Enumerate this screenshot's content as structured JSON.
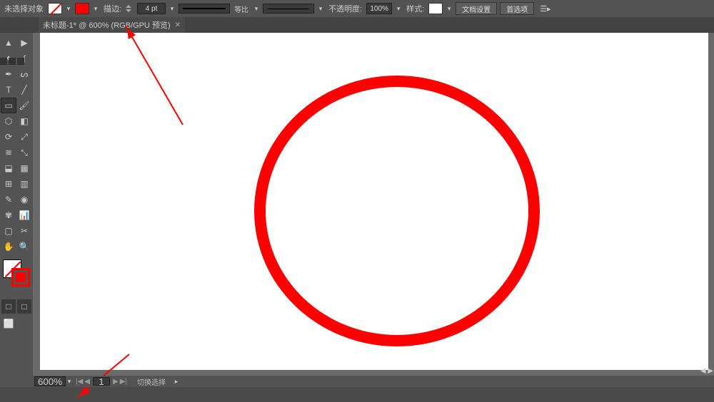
{
  "optionsBar": {
    "leftLabel": "未选择对象",
    "strokeLabel": "描边:",
    "strokeValue": "4 pt",
    "strokeProfileLabel": "等比",
    "opacityLabel": "不透明度:",
    "opacityValue": "100%",
    "styleLabel": "样式:",
    "docSetupBtn": "文档设置",
    "prefsBtn": "首选项"
  },
  "tabs": {
    "doc1": "未标题-1* @ 600% (RGB/GPU 预览)"
  },
  "tools": {
    "selection": "▲",
    "directSelection": "▶",
    "magicWand": "✦",
    "lasso": "ʃ",
    "pen": "✒",
    "curvature": "ᔕ",
    "type": "T",
    "lineSegment": "╱",
    "rectangle": "▭",
    "paintbrush": "🖌",
    "shaper": "⬡",
    "eraser": "◧",
    "rotate": "⟳",
    "scale": "⤢",
    "widthTool": "≋",
    "freeTransform": "⤡",
    "shapeBuilder": "⬓",
    "perspective": "▦",
    "mesh": "⊞",
    "gradient": "▥",
    "eyedropper": "✎",
    "blend": "◉",
    "symbolSprayer": "✾",
    "columnGraph": "📊",
    "artboardTool": "▢",
    "slice": "✂",
    "hand": "✋",
    "zoom": "🔍",
    "normal": "□",
    "fullscreen": "⬜"
  },
  "statusBar": {
    "zoom": "600%",
    "artboardNum": "1",
    "selectionStatus": "切换选择"
  },
  "annotationColor": "#ff0000",
  "shape": {
    "type": "circle",
    "stroke": "#ff0000",
    "strokeWidth": 16,
    "fill": "none"
  }
}
